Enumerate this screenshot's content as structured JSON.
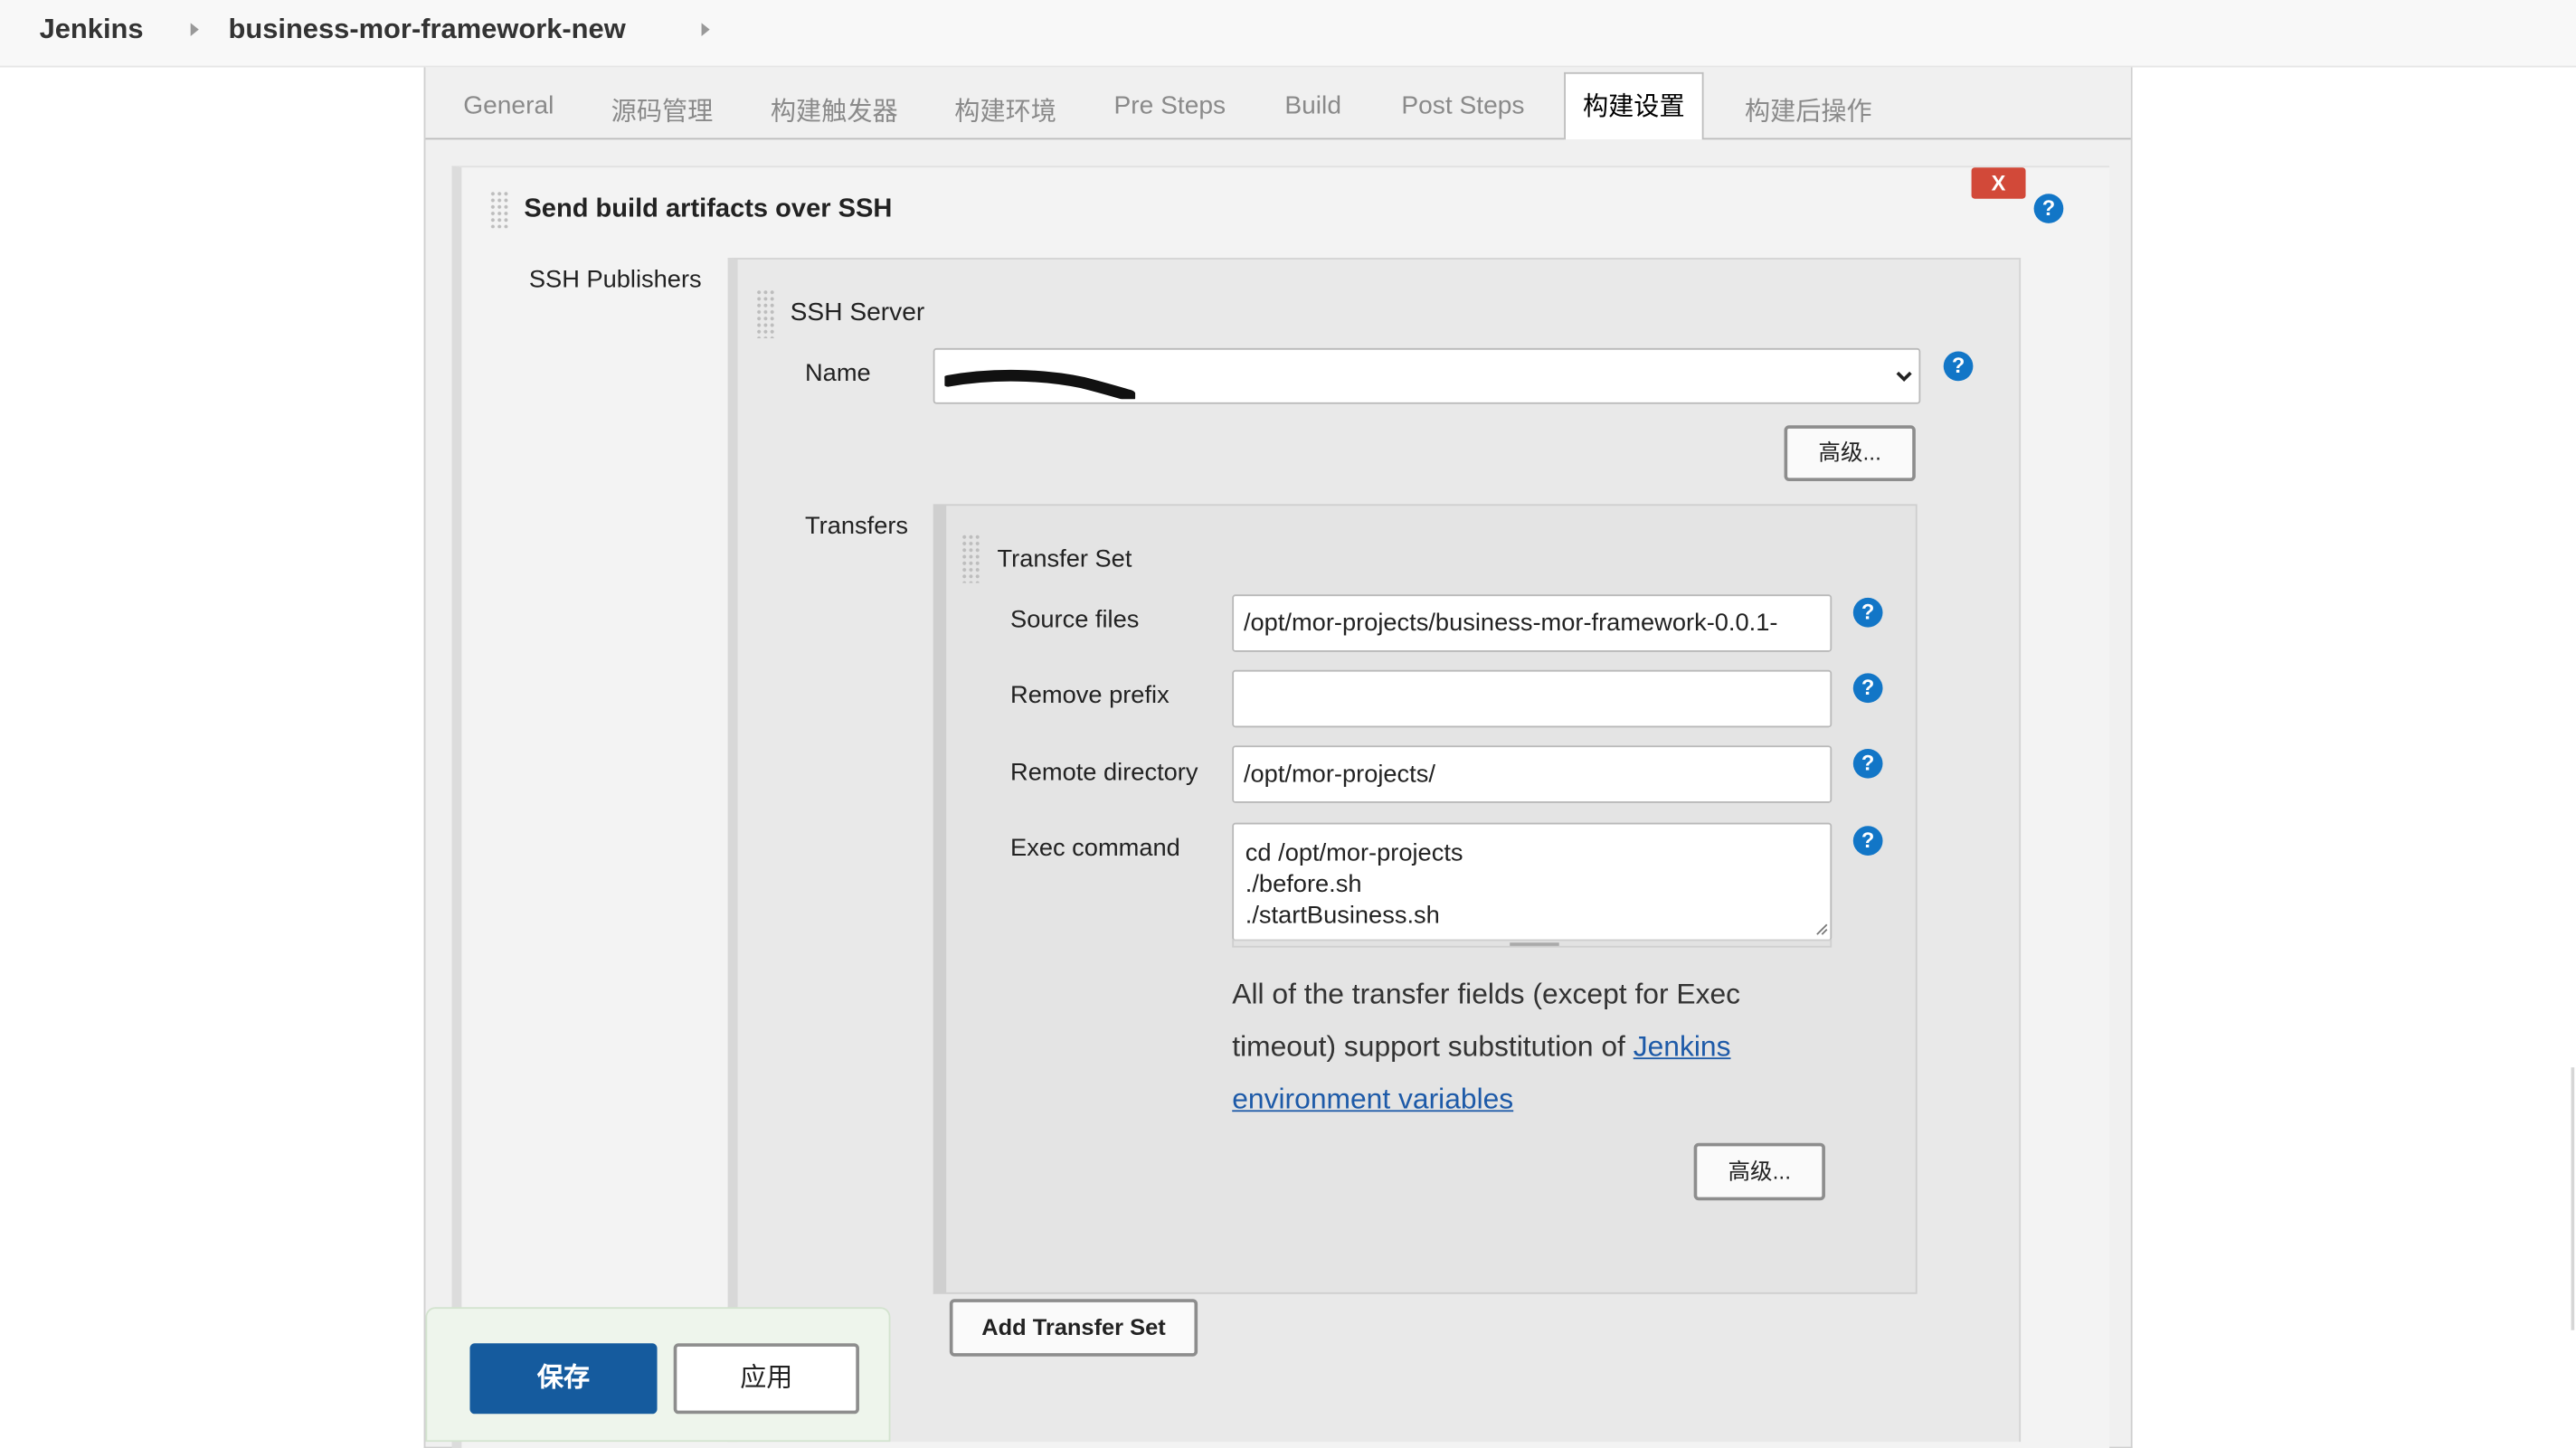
{
  "breadcrumb": {
    "root": "Jenkins",
    "job": "business-mor-framework-new"
  },
  "tabs": [
    {
      "label": "General"
    },
    {
      "label": "源码管理"
    },
    {
      "label": "构建触发器"
    },
    {
      "label": "构建环境"
    },
    {
      "label": "Pre Steps"
    },
    {
      "label": "Build"
    },
    {
      "label": "Post Steps"
    },
    {
      "label": "构建设置",
      "active": true
    },
    {
      "label": "构建后操作"
    }
  ],
  "section": {
    "title": "Send build artifacts over SSH",
    "delete_label": "X",
    "help": "?"
  },
  "ssh_publishers": {
    "label": "SSH Publishers",
    "server_title": "SSH Server",
    "name_label": "Name",
    "name_value": "",
    "advanced_label": "高级..."
  },
  "transfers": {
    "label": "Transfers",
    "set_title": "Transfer Set",
    "source_files_label": "Source files",
    "source_files_value": "/opt/mor-projects/business-mor-framework-0.0.1-",
    "remove_prefix_label": "Remove prefix",
    "remove_prefix_value": "",
    "remote_directory_label": "Remote directory",
    "remote_directory_value": "/opt/mor-projects/",
    "exec_command_label": "Exec command",
    "exec_command_lines": [
      "cd /opt/mor-projects",
      "./before.sh",
      "./startBusiness.sh"
    ],
    "note_text": "All of the transfer fields (except for Exec timeout) support substitution of ",
    "note_link": "Jenkins environment variables",
    "advanced_label": "高级...",
    "add_label": "Add Transfer Set"
  },
  "footer": {
    "save_label": "保存",
    "apply_label": "应用"
  },
  "colors": {
    "primary": "#155b9e",
    "help": "#1276c7",
    "delete": "#d24939",
    "link": "#1d5aa8"
  }
}
